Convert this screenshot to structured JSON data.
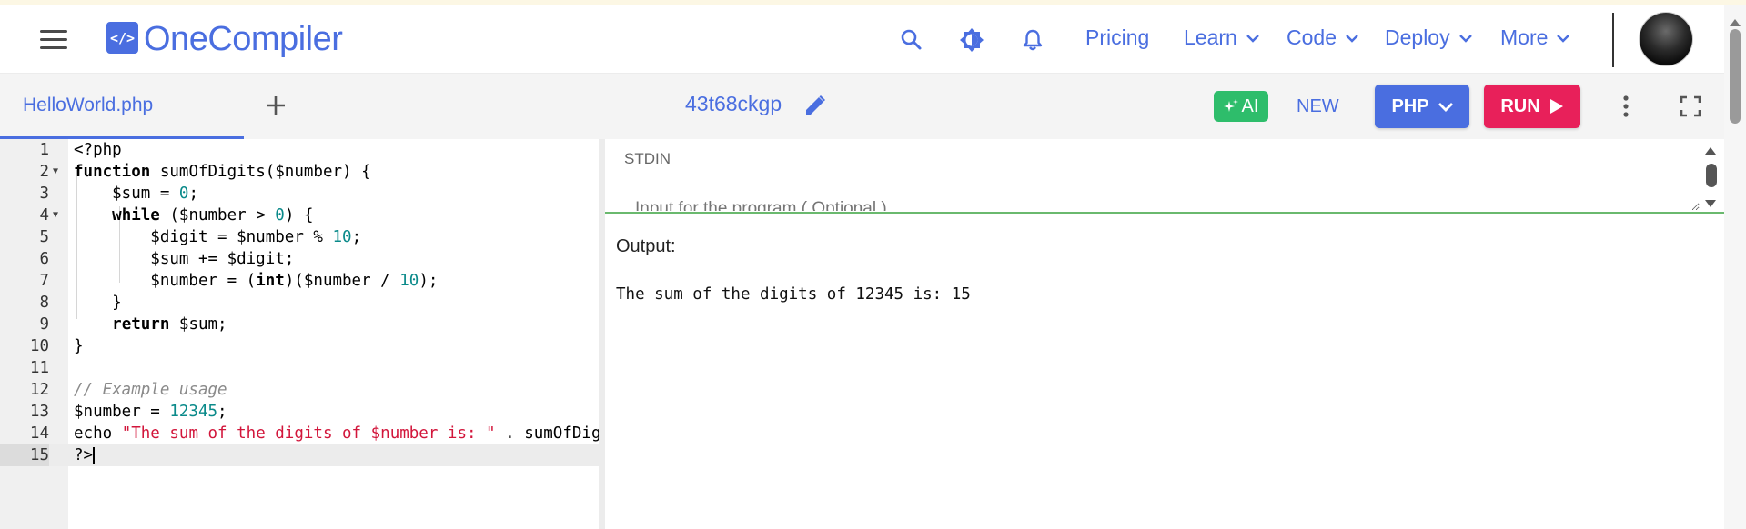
{
  "header": {
    "logo_symbol": "</>",
    "logo_text": "OneCompiler",
    "nav": [
      {
        "label": "Pricing"
      },
      {
        "label": "Learn"
      },
      {
        "label": "Code"
      },
      {
        "label": "Deploy"
      },
      {
        "label": "More"
      }
    ]
  },
  "toolbar": {
    "tab_label": "HelloWorld.php",
    "project_name": "43t68ckgp",
    "ai_label": "AI",
    "new_label": "NEW",
    "language_label": "PHP",
    "run_label": "RUN"
  },
  "editor": {
    "line_numbers": [
      "1",
      "2",
      "3",
      "4",
      "5",
      "6",
      "7",
      "8",
      "9",
      "10",
      "11",
      "12",
      "13",
      "14",
      "15"
    ],
    "active_line": 15
  },
  "stdin": {
    "label": "STDIN",
    "placeholder": "Input for the program ( Optional )"
  },
  "output": {
    "label": "Output:",
    "text": "The sum of the digits of 12345 is: 15"
  },
  "colors": {
    "brand": "#4a6ee0",
    "ai_green": "#2ebd6b",
    "run_pink": "#e8205a",
    "keyword": "#000000",
    "number": "#0a8a8a",
    "string": "#d2163b",
    "comment": "#8a8a8a"
  }
}
